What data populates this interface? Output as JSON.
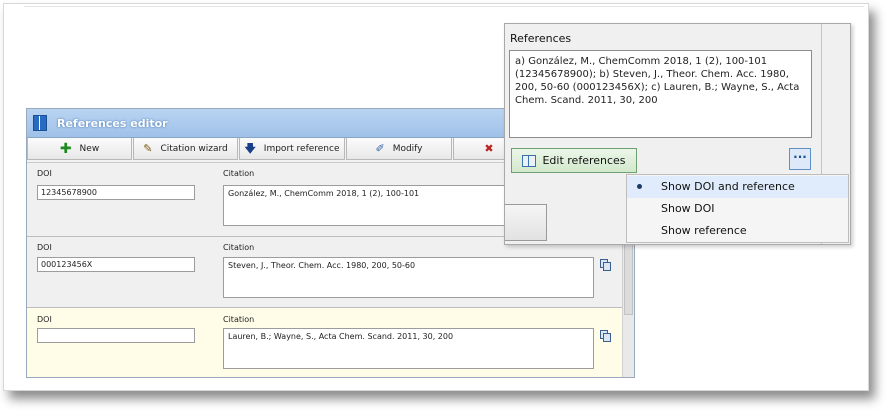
{
  "editor": {
    "title": "References editor",
    "toolbar": [
      {
        "label": "New",
        "icon": "plus-icon"
      },
      {
        "label": "Citation wizard",
        "icon": "wizard-icon"
      },
      {
        "label": "Import reference",
        "icon": "arrow-down-icon"
      },
      {
        "label": "Modify",
        "icon": "pencil-icon"
      },
      {
        "label": "",
        "icon": "delete-icon"
      }
    ],
    "doi_label": "DOI",
    "citation_label": "Citation",
    "rows": [
      {
        "doi": "12345678900",
        "citation": "González, M., ChemComm 2018, 1 (2), 100-101"
      },
      {
        "doi": "000123456X",
        "citation": "Steven, J., Theor. Chem. Acc. 1980, 200, 50-60"
      },
      {
        "doi": "",
        "citation": "Lauren, B.; Wayne, S., Acta Chem. Scand. 2011, 30, 200"
      }
    ]
  },
  "references_panel": {
    "title": "References",
    "text": "a) González, M., ChemComm 2018, 1 (2), 100-101 (12345678900); b) Steven, J., Theor. Chem. Acc. 1980, 200, 50-60 (000123456X); c) Lauren, B.; Wayne, S., Acta Chem. Scand. 2011, 30, 200",
    "edit_button": "Edit references",
    "more_button": "···",
    "menu": [
      {
        "label": "Show DOI and reference",
        "selected": true
      },
      {
        "label": "Show DOI",
        "selected": false
      },
      {
        "label": "Show reference",
        "selected": false
      }
    ]
  }
}
